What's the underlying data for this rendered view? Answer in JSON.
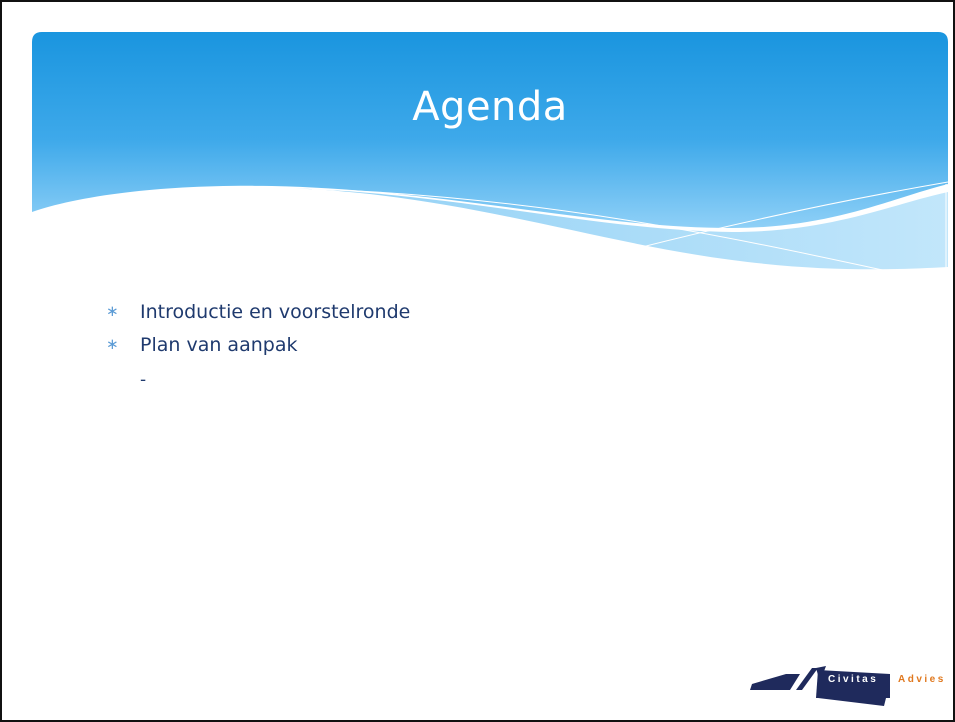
{
  "slide": {
    "title": "Agenda",
    "bullets": [
      "Introductie en voorstelronde",
      "Plan van aanpak"
    ],
    "sub_item": "-"
  },
  "logo": {
    "word1": "Civitas",
    "word2": "Advies"
  },
  "colors": {
    "header_top": "#1a95df",
    "header_bottom": "#8fd0f7",
    "text": "#1f3a6e",
    "bullet": "#5b9bd5",
    "logo_navy": "#1f2a5c",
    "logo_orange": "#e0781e"
  },
  "icons": {
    "bullet": "asterisk-bullet-icon",
    "logo": "civitas-advies-logo"
  }
}
